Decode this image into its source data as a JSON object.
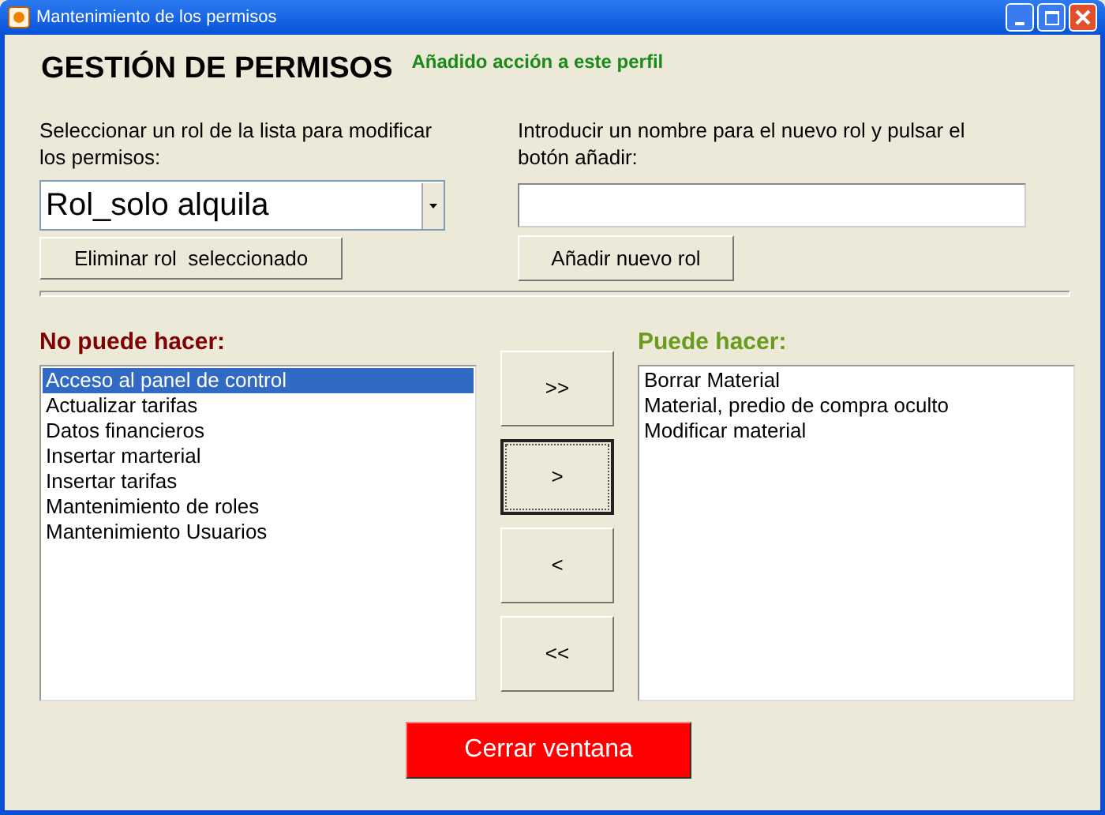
{
  "window": {
    "title": "Mantenimiento de los permisos"
  },
  "heading": "GESTIÓN DE PERMISOS",
  "status_message": "Añadido acción a este perfil",
  "role_select": {
    "label": "Seleccionar un rol de la lista para modificar los permisos:",
    "value": "Rol_solo alquila"
  },
  "delete_button": "Eliminar rol  seleccionado",
  "new_role": {
    "label": "Introducir un nombre para el nuevo rol y pulsar el botón añadir:"
  },
  "add_button": "Añadir nuevo rol",
  "denied": {
    "title": "No puede hacer:",
    "items": [
      {
        "label": "Acceso al panel de control",
        "selected": true
      },
      {
        "label": "Actualizar tarifas",
        "selected": false
      },
      {
        "label": "Datos financieros",
        "selected": false
      },
      {
        "label": "Insertar marterial",
        "selected": false
      },
      {
        "label": "Insertar tarifas",
        "selected": false
      },
      {
        "label": "Mantenimiento de roles",
        "selected": false
      },
      {
        "label": "Mantenimiento Usuarios",
        "selected": false
      }
    ]
  },
  "move_buttons": [
    {
      "label": ">>",
      "focused": false
    },
    {
      "label": ">",
      "focused": true
    },
    {
      "label": "<",
      "focused": false
    },
    {
      "label": "<<",
      "focused": false
    }
  ],
  "allowed": {
    "title": "Puede hacer:",
    "items": [
      {
        "label": "Borrar Material",
        "selected": false
      },
      {
        "label": "Material, predio de compra oculto",
        "selected": false
      },
      {
        "label": "Modificar material",
        "selected": false
      }
    ]
  },
  "close_button": "Cerrar ventana"
}
